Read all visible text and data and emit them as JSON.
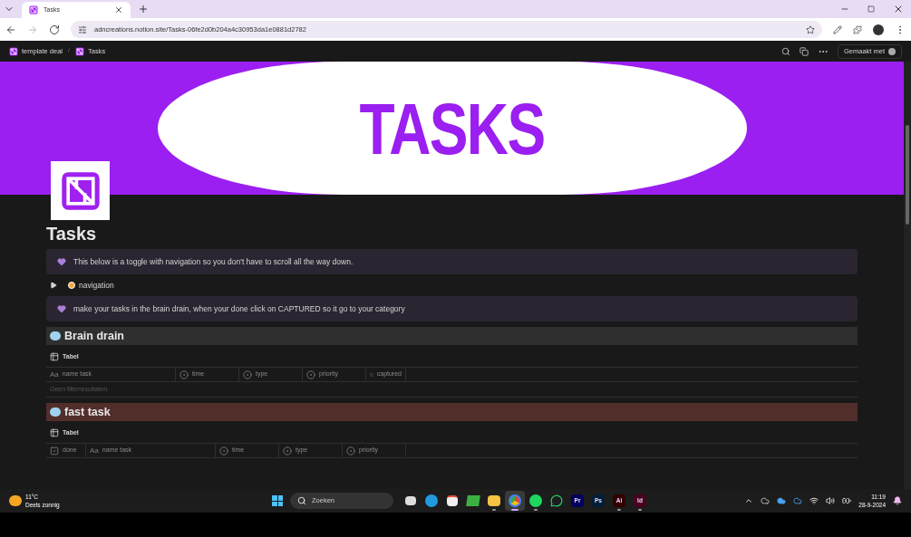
{
  "browser": {
    "tab_title": "Tasks",
    "url": "adncreations.notion.site/Tasks-06fe2d0b204a4c30953da1e0881d2782"
  },
  "topbar": {
    "breadcrumbs": [
      "template deal",
      "Tasks"
    ],
    "separator": "/",
    "made_with": "Gemaakt met"
  },
  "banner": {
    "title": "TASKS"
  },
  "page_title": "Tasks",
  "blocks": [
    {
      "kind": "callout",
      "text": "This below is a toggle with navigation so you don't have to scroll all the way down."
    },
    {
      "kind": "toggle",
      "text": "navigation",
      "expanded": false
    },
    {
      "kind": "callout",
      "text": "make your tasks in the brain drain, when your done click on CAPTURED so it go to your category"
    },
    {
      "kind": "heading",
      "text": "Brain drain",
      "color": "#2f2f2f"
    },
    {
      "kind": "table",
      "view": "Tabel",
      "columns": [
        {
          "kind": "title",
          "icon": "Aa",
          "label": "name task"
        },
        {
          "kind": "select",
          "label": "time"
        },
        {
          "kind": "select",
          "label": "type"
        },
        {
          "kind": "select",
          "label": "priority"
        },
        {
          "kind": "checkbox",
          "label": "captured"
        }
      ],
      "empty": "Geen filterresultaten."
    },
    {
      "kind": "heading",
      "text": "fast task",
      "color": "#522e2a"
    },
    {
      "kind": "table",
      "view": "Tabel",
      "columns": [
        {
          "kind": "checkbox",
          "label": "done"
        },
        {
          "kind": "title",
          "icon": "Aa",
          "label": "name task"
        },
        {
          "kind": "select",
          "label": "time"
        },
        {
          "kind": "select",
          "label": "type"
        },
        {
          "kind": "select",
          "label": "priority"
        }
      ]
    }
  ],
  "taskbar": {
    "weather": {
      "temp": "11°C",
      "desc": "Deels zonnig"
    },
    "search": {
      "placeholder": "Zoeken"
    },
    "apps": [
      {
        "kind": "taskview",
        "open": false,
        "selected": false
      },
      {
        "kind": "edge",
        "open": false,
        "selected": false
      },
      {
        "kind": "store",
        "open": false,
        "selected": false
      },
      {
        "kind": "widget",
        "open": false,
        "selected": false
      },
      {
        "kind": "folder",
        "open": true,
        "selected": false
      },
      {
        "kind": "chrome",
        "open": true,
        "selected": true
      },
      {
        "kind": "spotify",
        "open": true,
        "selected": false
      },
      {
        "kind": "whatsapp",
        "open": false,
        "selected": false
      },
      {
        "kind": "badge",
        "label": "Pr",
        "color": "#00005b",
        "open": false,
        "selected": false
      },
      {
        "kind": "badge",
        "label": "Ps",
        "color": "#001e36",
        "open": false,
        "selected": false
      },
      {
        "kind": "badge",
        "label": "Ai",
        "color": "#330000",
        "open": true,
        "selected": false
      },
      {
        "kind": "badge",
        "label": "Id",
        "color": "#49021f",
        "open": true,
        "selected": false
      }
    ],
    "time": "11:19",
    "date": "28-9-2024"
  }
}
